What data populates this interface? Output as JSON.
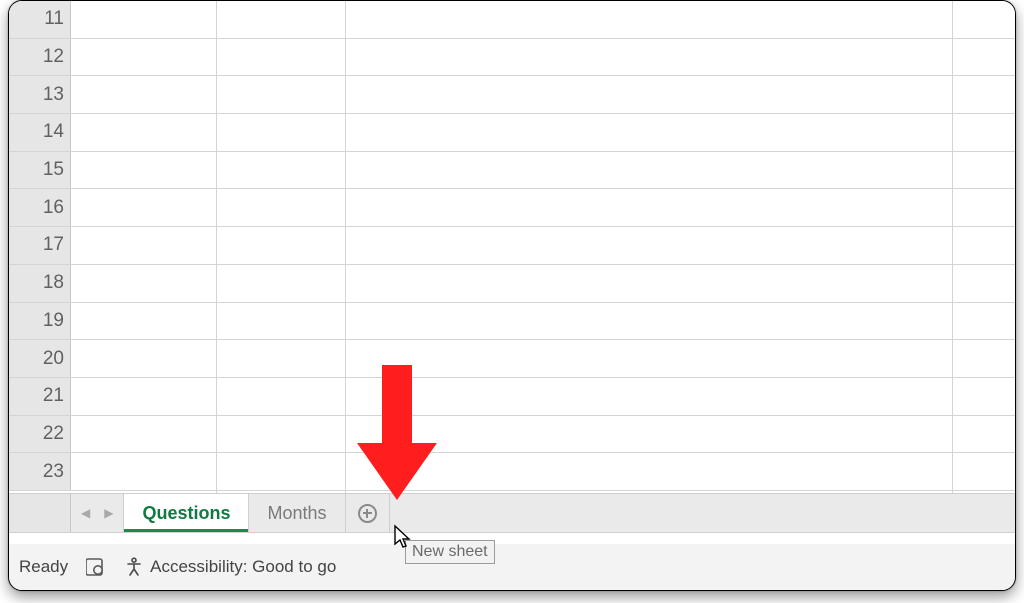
{
  "rows": [
    "11",
    "12",
    "13",
    "14",
    "15",
    "16",
    "17",
    "18",
    "19",
    "20",
    "21",
    "22",
    "23"
  ],
  "tabs": {
    "active": "Questions",
    "inactive": "Months"
  },
  "tooltip": "New sheet",
  "status": {
    "ready": "Ready",
    "accessibility": "Accessibility: Good to go"
  },
  "annotation": {
    "color": "#ff1e1e"
  }
}
